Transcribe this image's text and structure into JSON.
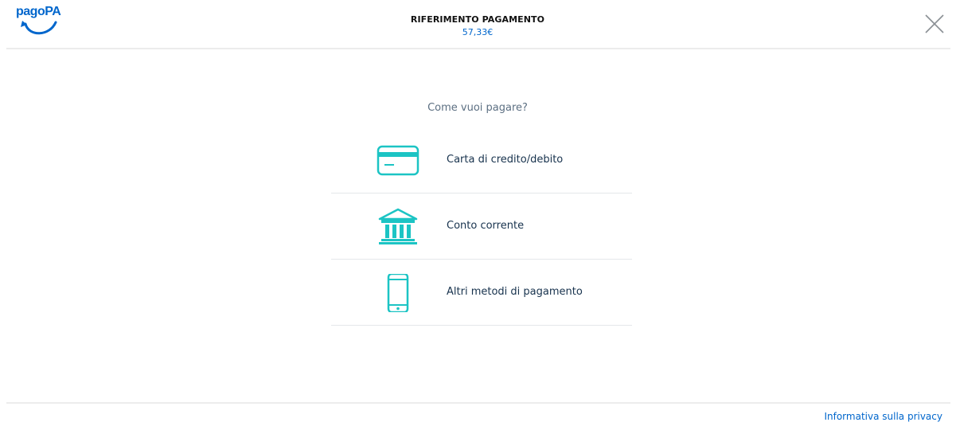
{
  "header": {
    "logo_text": "pagoPA",
    "reference_title": "RIFERIMENTO PAGAMENTO",
    "amount": "57,33€",
    "close_icon": "close-icon"
  },
  "main": {
    "question": "Come vuoi pagare?",
    "methods": [
      {
        "label": "Carta di credito/debito",
        "icon": "credit-card-icon"
      },
      {
        "label": "Conto corrente",
        "icon": "bank-icon"
      },
      {
        "label": "Altri metodi di pagamento",
        "icon": "smartphone-icon"
      }
    ]
  },
  "footer": {
    "privacy_link": "Informativa sulla privacy"
  },
  "colors": {
    "brand_blue": "#0066cc",
    "icon_teal": "#1cc4c4",
    "text_dark": "#17324d",
    "text_muted": "#5c6f82"
  }
}
